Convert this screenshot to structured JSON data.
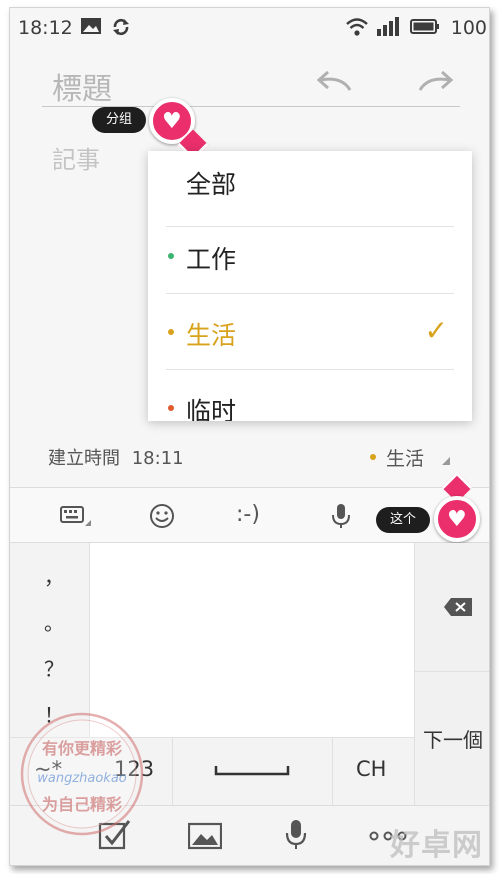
{
  "status_bar": {
    "time": "18:12",
    "battery": "100"
  },
  "note": {
    "title_placeholder": "標題",
    "body_placeholder": "記事"
  },
  "tooltips": {
    "group": "分组",
    "this": "这个"
  },
  "group_menu": {
    "options": [
      {
        "label": "全部",
        "dot_color": null,
        "selected": false
      },
      {
        "label": "工作",
        "dot_color": "#3cb371",
        "selected": false
      },
      {
        "label": "生活",
        "dot_color": "#d9a21c",
        "selected": true
      },
      {
        "label": "临时",
        "dot_color": "#e05a2b",
        "selected": false
      }
    ],
    "selected_color": "#d9a21c"
  },
  "meta": {
    "created_label": "建立時間",
    "created_time": "18:11",
    "category": "生活"
  },
  "keyboard": {
    "toolbar": [
      "keyboard-icon",
      "emoji-icon",
      ":-)",
      "mic-icon"
    ],
    "punctuation": [
      "，",
      "。",
      "？",
      "！"
    ],
    "bottom_row": {
      "symbols": "~*",
      "numbers": "123",
      "lang": "CH"
    },
    "next": "下一個"
  },
  "accent_color": "#ea2f6c",
  "watermark": {
    "stamp_top": "有你更精彩",
    "stamp_url": "wangzhaokao",
    "stamp_bottom": "为自己精彩",
    "site": "好卓网"
  }
}
